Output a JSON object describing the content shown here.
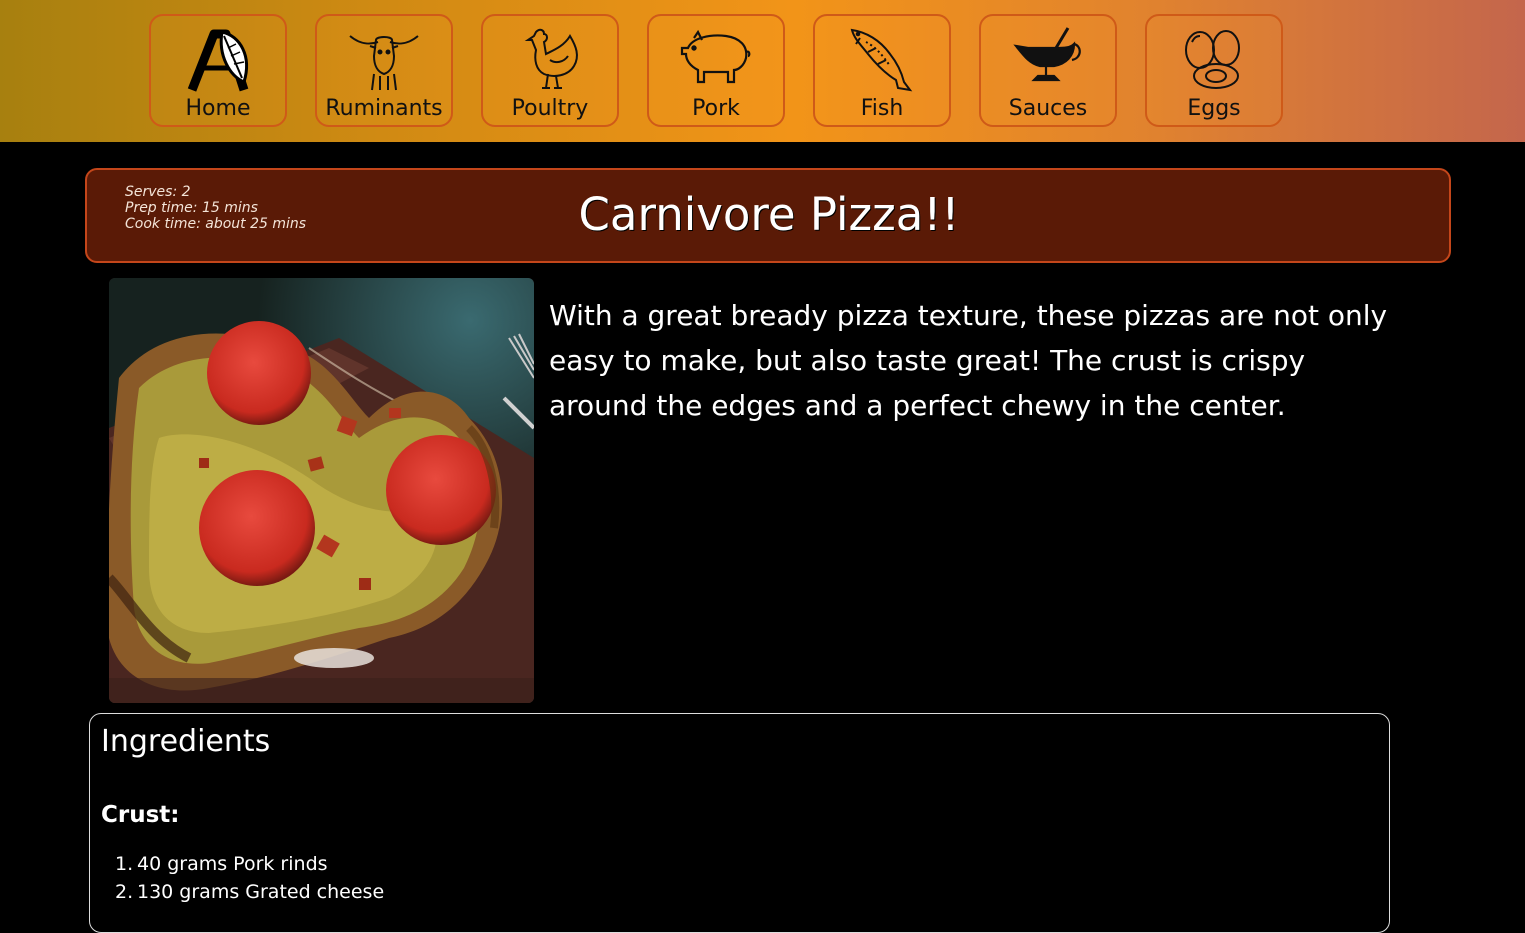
{
  "nav": {
    "items": [
      {
        "label": "Home",
        "icon": "logo-a-leaf-icon"
      },
      {
        "label": "Ruminants",
        "icon": "longhorn-bull-icon"
      },
      {
        "label": "Poultry",
        "icon": "chicken-icon"
      },
      {
        "label": "Pork",
        "icon": "pig-icon"
      },
      {
        "label": "Fish",
        "icon": "fish-icon"
      },
      {
        "label": "Sauces",
        "icon": "gravy-boat-icon"
      },
      {
        "label": "Eggs",
        "icon": "eggs-icon"
      }
    ]
  },
  "recipe": {
    "serves": "Serves: 2",
    "prep_time": "Prep time: 15 mins",
    "cook_time": "Cook time: about 25 mins",
    "title": "Carnivore Pizza!!",
    "description": "With a great bready pizza texture, these pizzas are not only easy to make, but also taste great! The crust is crispy around the edges and a perfect chewy in the center."
  },
  "ingredients": {
    "heading": "Ingredients",
    "sections": [
      {
        "title": "Crust:",
        "items": [
          {
            "num": "1.",
            "text": "40 grams Pork rinds"
          },
          {
            "num": "2.",
            "text": "130 grams Grated cheese"
          }
        ]
      }
    ]
  },
  "colors": {
    "nav_gradient_start": "#a7800f",
    "nav_gradient_mid": "#f29418",
    "nav_gradient_end": "#c4664c",
    "header_bg": "#5a1a06",
    "header_border": "#c4461a",
    "page_bg": "#000000"
  }
}
